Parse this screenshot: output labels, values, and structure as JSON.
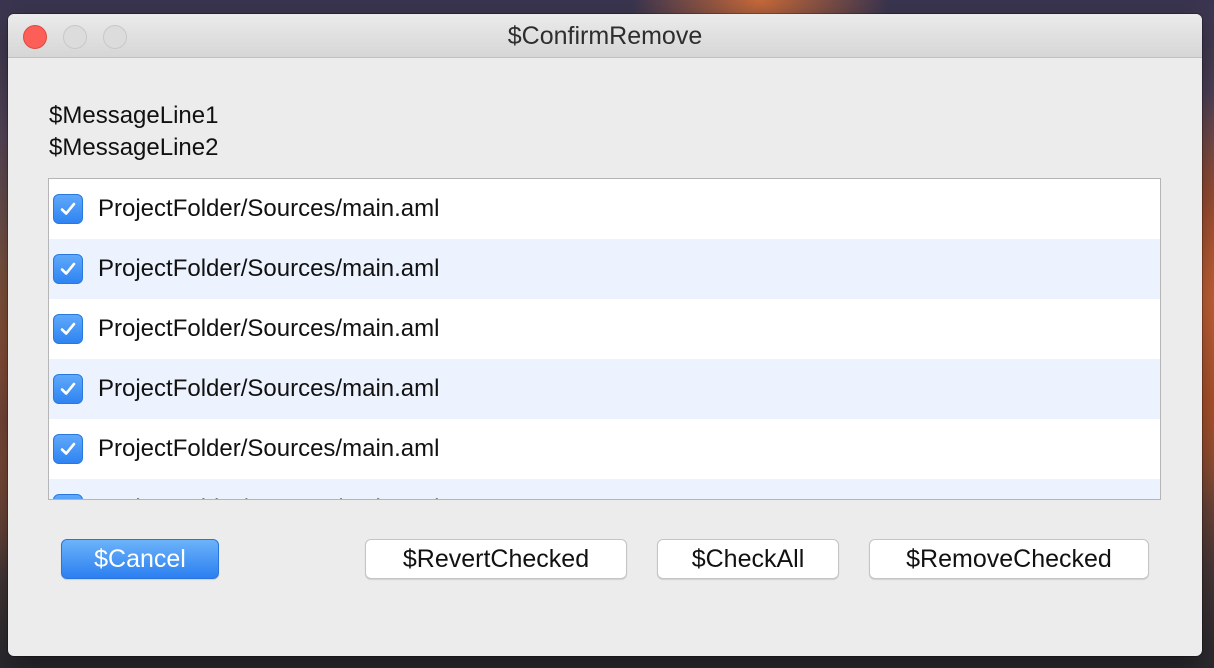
{
  "window": {
    "title": "$ConfirmRemove"
  },
  "message": {
    "line1": "$MessageLine1",
    "line2": "$MessageLine2"
  },
  "files": [
    {
      "path": "ProjectFolder/Sources/main.aml",
      "checked": true
    },
    {
      "path": "ProjectFolder/Sources/main.aml",
      "checked": true
    },
    {
      "path": "ProjectFolder/Sources/main.aml",
      "checked": true
    },
    {
      "path": "ProjectFolder/Sources/main.aml",
      "checked": true
    },
    {
      "path": "ProjectFolder/Sources/main.aml",
      "checked": true
    },
    {
      "path": "ProjectFolder/Sources/main.aml",
      "checked": true
    }
  ],
  "buttons": {
    "cancel": "$Cancel",
    "revert_checked": "$RevertChecked",
    "check_all": "$CheckAll",
    "remove_checked": "$RemoveChecked"
  },
  "colors": {
    "accent": "#2f84f2",
    "close": "#fc5f57",
    "row_alt": "#edf3fe"
  }
}
